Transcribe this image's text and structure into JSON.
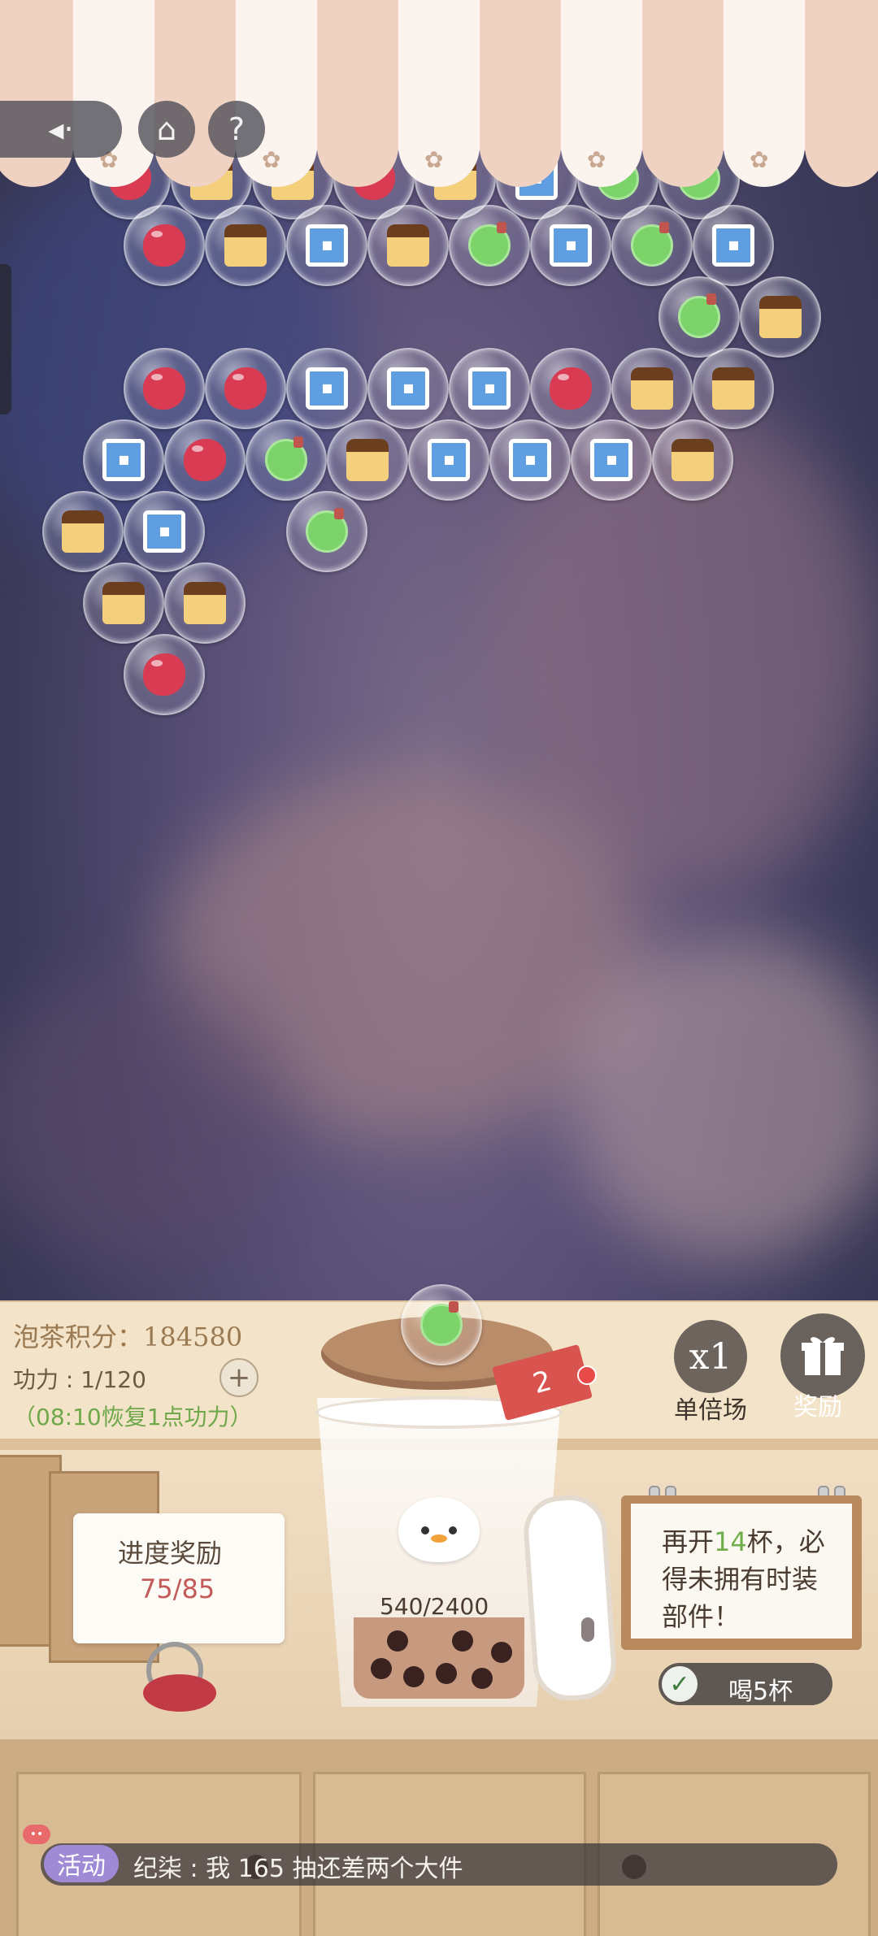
{
  "score": {
    "label": "泡茶积分：",
    "value": "184580"
  },
  "power": {
    "text": "功力 : 1/120",
    "recover": "（08:10恢复1点功力）"
  },
  "multiplier": {
    "value": "x1",
    "label": "单倍场"
  },
  "reward": {
    "label": "奖励"
  },
  "tag": {
    "count": "2"
  },
  "cup": {
    "progress": "540/2400"
  },
  "progress_reward": {
    "title": "进度奖励",
    "value": "75/85"
  },
  "notice": {
    "line1_pre": "再开",
    "line1_num": "14",
    "line1_post": "杯，必",
    "line2": "得未拥有时装",
    "line3": "部件！"
  },
  "drink": {
    "label": "喝5杯"
  },
  "chat": {
    "tag": "活动",
    "text": "纪柒 : 我 165 抽还差两个大件",
    "badge": "••"
  },
  "icons": {
    "back": "speaker-arrow-icon",
    "home": "home-icon",
    "help": "question-icon",
    "gift": "gift-icon",
    "check": "check-icon",
    "plus": "plus-icon"
  },
  "bubbles": [
    {
      "type": "bean",
      "row": "r0"
    },
    {
      "type": "pudding",
      "row": "r0"
    },
    {
      "type": "pudding",
      "row": "r0"
    },
    {
      "type": "bean",
      "row": "r0"
    },
    {
      "type": "pudding",
      "row": "r0"
    },
    {
      "type": "milk",
      "row": "r0"
    },
    {
      "type": "melon",
      "row": "r0"
    },
    {
      "type": "melon",
      "row": "r0"
    },
    {
      "type": "bean",
      "row": "r1"
    },
    {
      "type": "pudding",
      "row": "r1"
    },
    {
      "type": "milk",
      "row": "r1"
    },
    {
      "type": "pudding",
      "row": "r1"
    },
    {
      "type": "melon",
      "row": "r1"
    },
    {
      "type": "milk",
      "row": "r1"
    },
    {
      "type": "melon",
      "row": "r1"
    },
    {
      "type": "milk",
      "row": "r1"
    },
    {
      "type": "melon",
      "row": "r2"
    },
    {
      "type": "pudding",
      "row": "r2"
    },
    {
      "type": "bean",
      "row": "r3"
    },
    {
      "type": "bean",
      "row": "r3"
    },
    {
      "type": "milk",
      "row": "r3"
    },
    {
      "type": "milk",
      "row": "r3"
    },
    {
      "type": "milk",
      "row": "r3"
    },
    {
      "type": "bean",
      "row": "r3"
    },
    {
      "type": "pudding",
      "row": "r3"
    },
    {
      "type": "pudding",
      "row": "r3"
    },
    {
      "type": "milk",
      "row": "r4"
    },
    {
      "type": "bean",
      "row": "r4"
    },
    {
      "type": "melon",
      "row": "r4"
    },
    {
      "type": "pudding",
      "row": "r4"
    },
    {
      "type": "milk",
      "row": "r4"
    },
    {
      "type": "milk",
      "row": "r4"
    },
    {
      "type": "milk",
      "row": "r4"
    },
    {
      "type": "pudding",
      "row": "r4"
    },
    {
      "type": "pudding",
      "row": "r5"
    },
    {
      "type": "milk",
      "row": "r5"
    },
    {
      "type": "melon",
      "row": "r5"
    },
    {
      "type": "pudding",
      "row": "r6"
    },
    {
      "type": "pudding",
      "row": "r6"
    },
    {
      "type": "bean",
      "row": "r7"
    }
  ],
  "next_bubble": {
    "type": "melon"
  }
}
